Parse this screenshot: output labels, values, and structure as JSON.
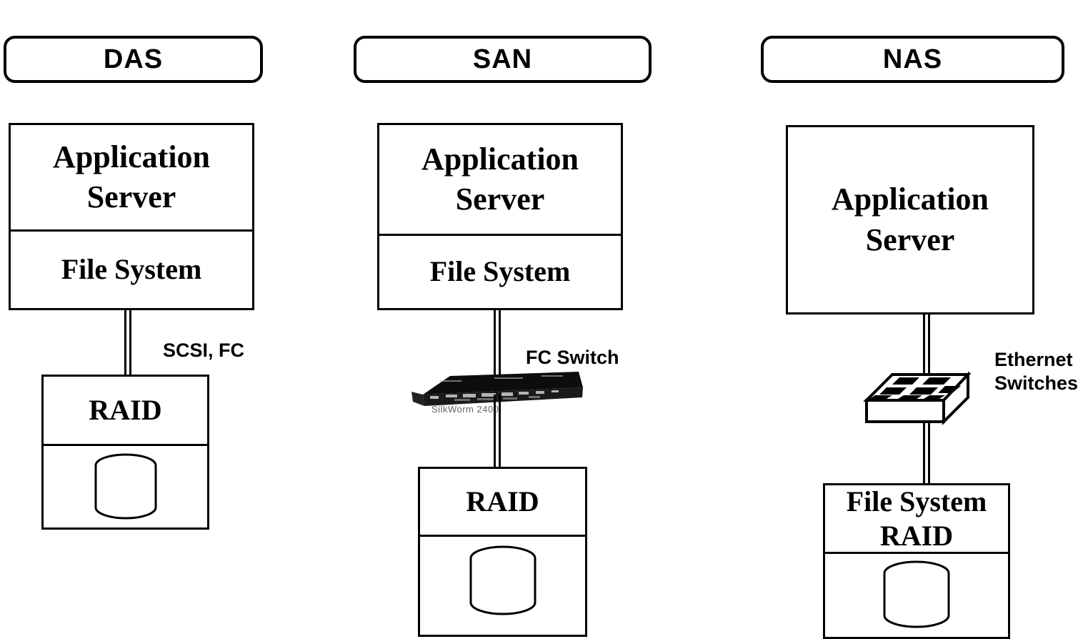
{
  "diagram": {
    "title_columns": [
      "DAS",
      "SAN",
      "NAS"
    ]
  },
  "columns": [
    {
      "key": "das",
      "header": "DAS",
      "server_box": {
        "top_cell": "Application\nServer",
        "bottom_cell": "File System"
      },
      "link_label": "SCSI, FC",
      "storage_box": {
        "top_cell": "RAID",
        "has_disk": true
      },
      "device": null
    },
    {
      "key": "san",
      "header": "SAN",
      "server_box": {
        "top_cell": "Application\nServer",
        "bottom_cell": "File System"
      },
      "link_label": "FC Switch",
      "storage_box": {
        "top_cell": "RAID",
        "has_disk": true
      },
      "device": {
        "type": "fc-switch",
        "caption": "SilkWorm 2400"
      }
    },
    {
      "key": "nas",
      "header": "NAS",
      "server_box": {
        "top_cell": "Application\nServer",
        "bottom_cell": null
      },
      "link_label": "Ethernet\nSwitches",
      "storage_box": {
        "top_cell": "File System\nRAID",
        "has_disk": true
      },
      "device": {
        "type": "ethernet-switch",
        "caption": null
      }
    }
  ],
  "colors": {
    "stroke": "#000000",
    "background": "#ffffff",
    "device_dark": "#101010",
    "caption_gray": "#4a4a4a"
  }
}
